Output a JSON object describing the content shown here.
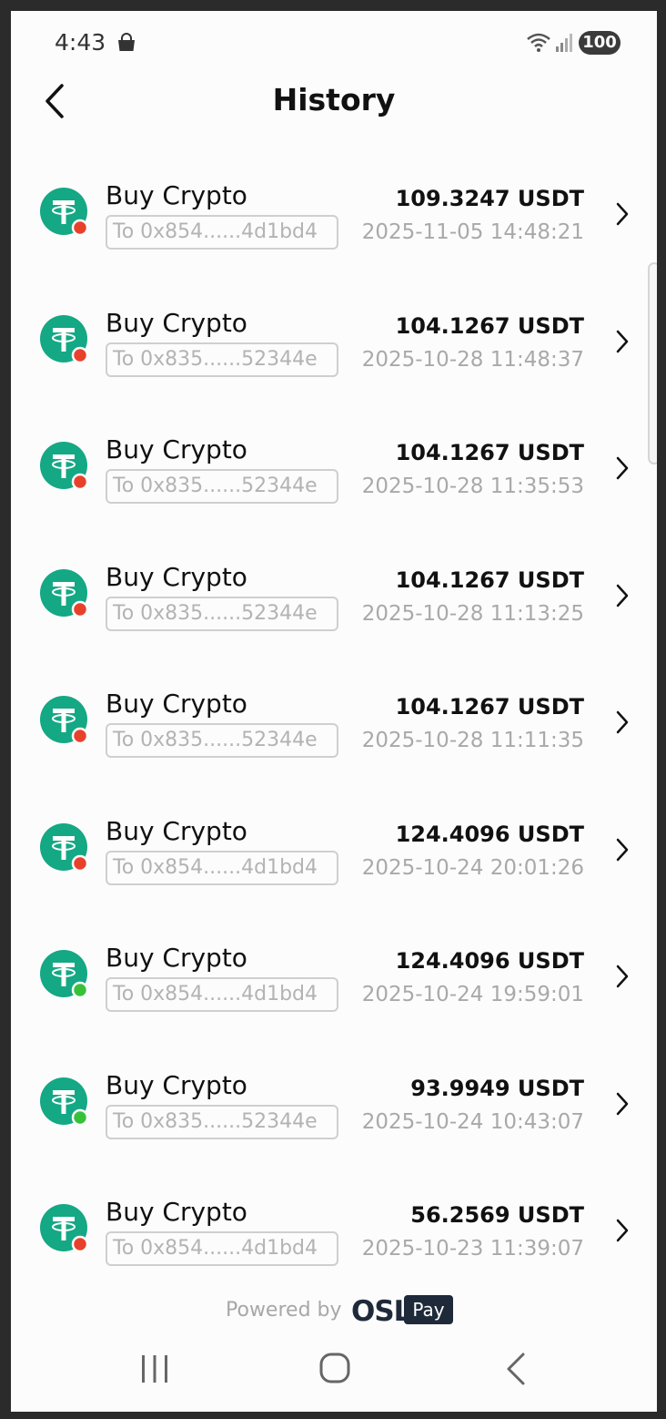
{
  "status_bar": {
    "time": "4:43",
    "battery": "100",
    "icons": [
      "shopping-bag-icon",
      "wifi-icon",
      "signal-icon"
    ]
  },
  "header": {
    "title": "History",
    "back_icon": "back-arrow-icon"
  },
  "colors": {
    "tether_green": "#14a884",
    "status_red": "#e8412b",
    "status_green": "#37c13a"
  },
  "transactions": [
    {
      "title": "Buy Crypto",
      "address": "To 0x854......4d1bd4",
      "amount": "109.3247 USDT",
      "date": "2025-11-05 14:48:21",
      "status_color": "#e8412b"
    },
    {
      "title": "Buy Crypto",
      "address": "To 0x835......52344e",
      "amount": "104.1267 USDT",
      "date": "2025-10-28 11:48:37",
      "status_color": "#e8412b"
    },
    {
      "title": "Buy Crypto",
      "address": "To 0x835......52344e",
      "amount": "104.1267 USDT",
      "date": "2025-10-28 11:35:53",
      "status_color": "#e8412b"
    },
    {
      "title": "Buy Crypto",
      "address": "To 0x835......52344e",
      "amount": "104.1267 USDT",
      "date": "2025-10-28 11:13:25",
      "status_color": "#e8412b"
    },
    {
      "title": "Buy Crypto",
      "address": "To 0x835......52344e",
      "amount": "104.1267 USDT",
      "date": "2025-10-28 11:11:35",
      "status_color": "#e8412b"
    },
    {
      "title": "Buy Crypto",
      "address": "To 0x854......4d1bd4",
      "amount": "124.4096 USDT",
      "date": "2025-10-24 20:01:26",
      "status_color": "#e8412b"
    },
    {
      "title": "Buy Crypto",
      "address": "To 0x854......4d1bd4",
      "amount": "124.4096 USDT",
      "date": "2025-10-24 19:59:01",
      "status_color": "#37c13a"
    },
    {
      "title": "Buy Crypto",
      "address": "To 0x835......52344e",
      "amount": "93.9949 USDT",
      "date": "2025-10-24 10:43:07",
      "status_color": "#37c13a"
    },
    {
      "title": "Buy Crypto",
      "address": "To 0x854......4d1bd4",
      "amount": "56.2569 USDT",
      "date": "2025-10-23 11:39:07",
      "status_color": "#e8412b"
    }
  ],
  "footer": {
    "powered_by": "Powered by",
    "brand": "OSL",
    "brand_badge": "Pay"
  },
  "nav_bar": {
    "icons": [
      "recents-icon",
      "home-icon",
      "back-icon"
    ]
  }
}
